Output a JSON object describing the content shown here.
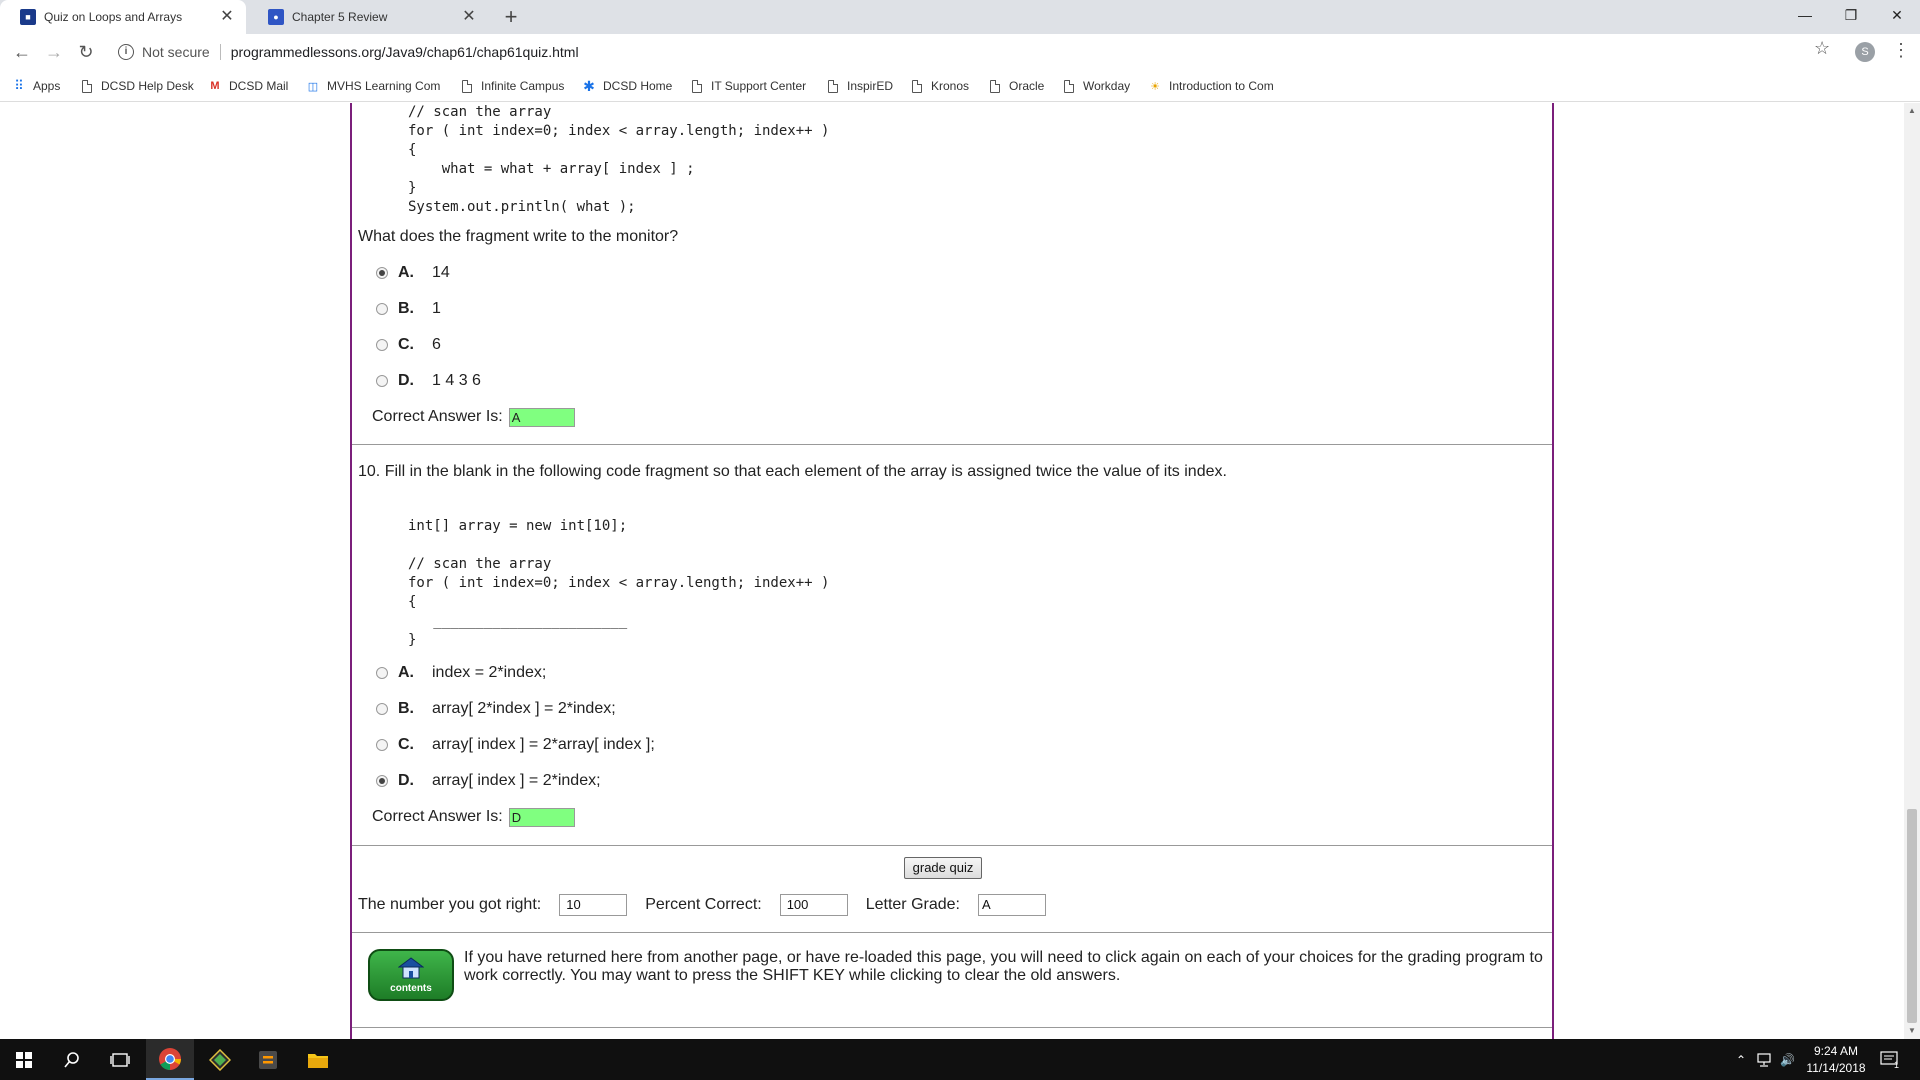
{
  "browser": {
    "tabs": [
      {
        "label": "Quiz on Loops and Arrays",
        "active": true,
        "favicon": "quiz-favicon"
      },
      {
        "label": "Chapter 5 Review",
        "active": false,
        "favicon": "person-favicon"
      }
    ],
    "security": "Not secure",
    "url": "programmedlessons.org/Java9/chap61/chap61quiz.html",
    "profile_initial": "S"
  },
  "bookmarks": [
    {
      "label": "Apps",
      "icon": "apps-grid-icon"
    },
    {
      "label": "DCSD Help Desk",
      "icon": "page-icon"
    },
    {
      "label": "DCSD Mail",
      "icon": "gmail-icon"
    },
    {
      "label": "MVHS Learning Com",
      "icon": "board-icon"
    },
    {
      "label": "Infinite Campus",
      "icon": "page-icon"
    },
    {
      "label": "DCSD Home",
      "icon": "dcsd-icon"
    },
    {
      "label": "IT Support Center",
      "icon": "page-icon"
    },
    {
      "label": "InspirED",
      "icon": "page-icon"
    },
    {
      "label": "Kronos",
      "icon": "page-icon"
    },
    {
      "label": "Oracle",
      "icon": "page-icon"
    },
    {
      "label": "Workday",
      "icon": "page-icon"
    },
    {
      "label": "Introduction to Com",
      "icon": "sun-icon"
    }
  ],
  "q9": {
    "code_lines": [
      "// scan the array",
      "for ( int index=0; index < array.length; index++ )",
      "{",
      "    what = what + array[ index ] ;",
      "}",
      "System.out.println( what );"
    ],
    "prompt": "What does the fragment write to the monitor?",
    "options": [
      {
        "letter": "A.",
        "text": "14",
        "checked": true
      },
      {
        "letter": "B.",
        "text": "1",
        "checked": false
      },
      {
        "letter": "C.",
        "text": "6",
        "checked": false
      },
      {
        "letter": "D.",
        "text": "1 4 3 6",
        "checked": false
      }
    ],
    "answer_label": "Correct Answer Is:",
    "answer_value": "A"
  },
  "q10": {
    "prompt": "10. Fill in the blank in the following code fragment so that each element of the array is assigned twice the value of its index.",
    "code_lines": [
      "int[] array = new int[10];",
      "",
      "// scan the array",
      "for ( int index=0; index < array.length; index++ )",
      "{",
      "   _______________________",
      "}"
    ],
    "options": [
      {
        "letter": "A.",
        "text": "index = 2*index;",
        "checked": false
      },
      {
        "letter": "B.",
        "text": "array[ 2*index ] = 2*index;",
        "checked": false
      },
      {
        "letter": "C.",
        "text": "array[ index ] = 2*array[ index ];",
        "checked": false
      },
      {
        "letter": "D.",
        "text": "array[ index ] = 2*index;",
        "checked": true
      }
    ],
    "answer_label": "Correct Answer Is:",
    "answer_value": "D"
  },
  "grading": {
    "button": "grade quiz",
    "right_label": "The number you got right:",
    "right_value": "10",
    "percent_label": "Percent Correct:",
    "percent_value": "100",
    "grade_label": "Letter Grade:",
    "grade_value": "A"
  },
  "footer": {
    "contents_label": "contents",
    "note": "If you have returned here from another page, or have re-loaded this page, you will need to click again on each of your choices for the grading program to work correctly. You may want to press the SHIFT KEY while clicking to clear the old answers."
  },
  "taskbar": {
    "time": "9:24 AM",
    "date": "11/14/2018",
    "notification_count": "1"
  },
  "colors": {
    "border_accent": "#7b1f7b",
    "answer_highlight": "#80ff80",
    "contents_button": "#2f9a3a"
  }
}
